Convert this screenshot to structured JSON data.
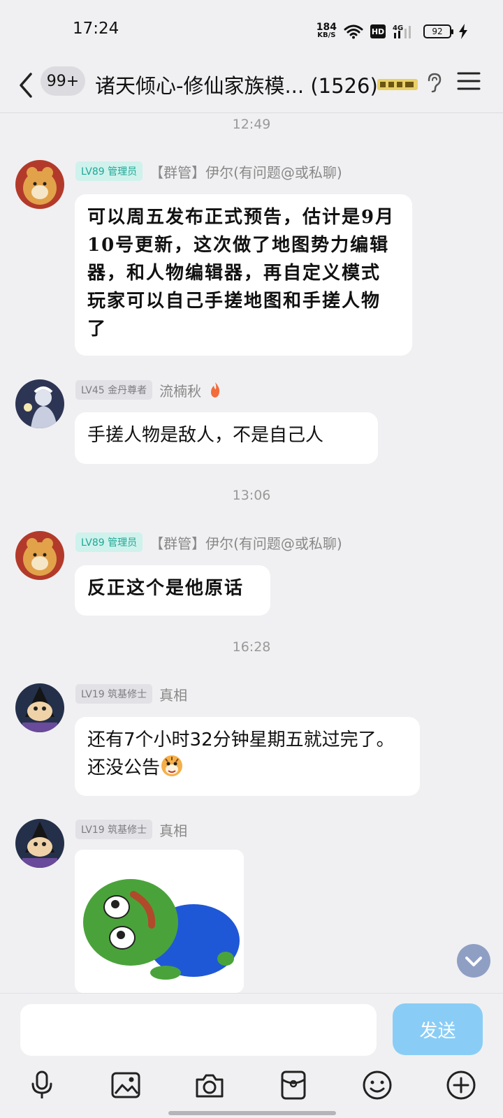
{
  "status_bar": {
    "time": "17:24",
    "net_speed": "184",
    "net_unit": "KB/S",
    "hd_label": "HD",
    "network": "4G",
    "battery_percent": "92"
  },
  "header": {
    "unread_count": "99+",
    "title": "诸天倾心-修仙家族模... (1526)"
  },
  "messages": [
    {
      "time": "12:49",
      "level": "LV89 管理员",
      "sender": "【群管】伊尔(有问题@或私聊)",
      "text": "可以周五发布正式预告，估计是9月10号更新，这次做了地图势力编辑器，和人物编辑器，再自定义模式玩家可以自己手搓地图和手搓人物了"
    },
    {
      "level": "LV45 金丹尊者",
      "sender": "流楠秋",
      "text": "手搓人物是敌人，不是自己人"
    },
    {
      "time": "13:06",
      "level": "LV89 管理员",
      "sender": "【群管】伊尔(有问题@或私聊)",
      "text": "反正这个是他原话"
    },
    {
      "time": "16:28",
      "level": "LV19 筑基修士",
      "sender": "真相",
      "text": "还有7个小时32分钟星期五就过完了。还没公告"
    },
    {
      "level": "LV19 筑基修士",
      "sender": "真相",
      "sticker": "pepe-frog-lying"
    }
  ],
  "input": {
    "value": "",
    "send_label": "发送"
  },
  "toolbar": [
    "microphone-icon",
    "image-icon",
    "camera-icon",
    "red-packet-icon",
    "emoji-icon",
    "plus-icon"
  ],
  "colors": {
    "background": "#f0f0f2",
    "bubble": "#ffffff",
    "admin_tag_bg": "#cff2ed",
    "admin_tag_text": "#20a795",
    "send_button": "#89cdf6",
    "scroll_button": "#8f9fc4"
  }
}
